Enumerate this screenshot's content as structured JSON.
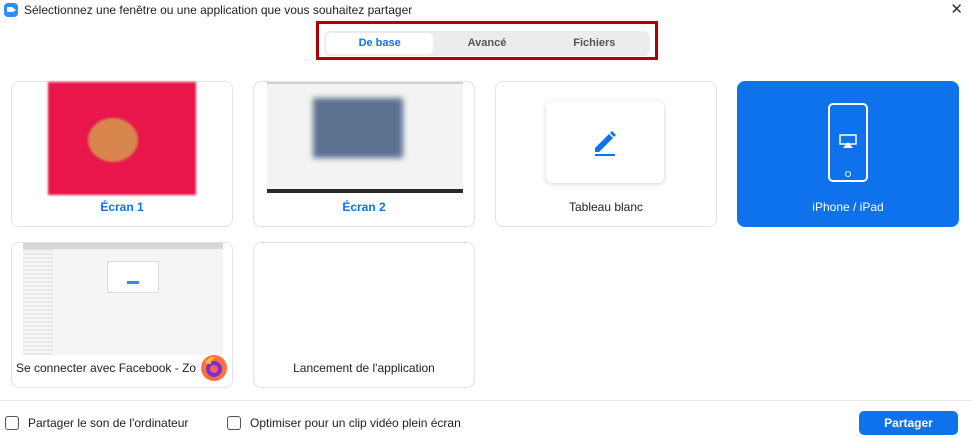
{
  "window": {
    "title": "Sélectionnez une fenêtre ou une application que vous souhaitez partager",
    "close_glyph": "✕"
  },
  "tabs": [
    {
      "label": "De base",
      "active": true
    },
    {
      "label": "Avancé",
      "active": false
    },
    {
      "label": "Fichiers",
      "active": false
    }
  ],
  "cards": {
    "ecran1": {
      "label": "Écran 1"
    },
    "ecran2": {
      "label": "Écran 2"
    },
    "tableau": {
      "label": "Tableau blanc"
    },
    "iphone": {
      "label": "iPhone / iPad",
      "selected": true
    },
    "facebook": {
      "label": "Se connecter avec Facebook - Zo..."
    },
    "lancement": {
      "label": "Lancement de l'application"
    }
  },
  "footer": {
    "share_sound_label": "Partager le son de l'ordinateur",
    "optimize_video_label": "Optimiser pour un clip vidéo plein écran",
    "share_button_label": "Partager"
  },
  "colors": {
    "accent": "#0e72ed",
    "highlight_border": "#b00000"
  }
}
